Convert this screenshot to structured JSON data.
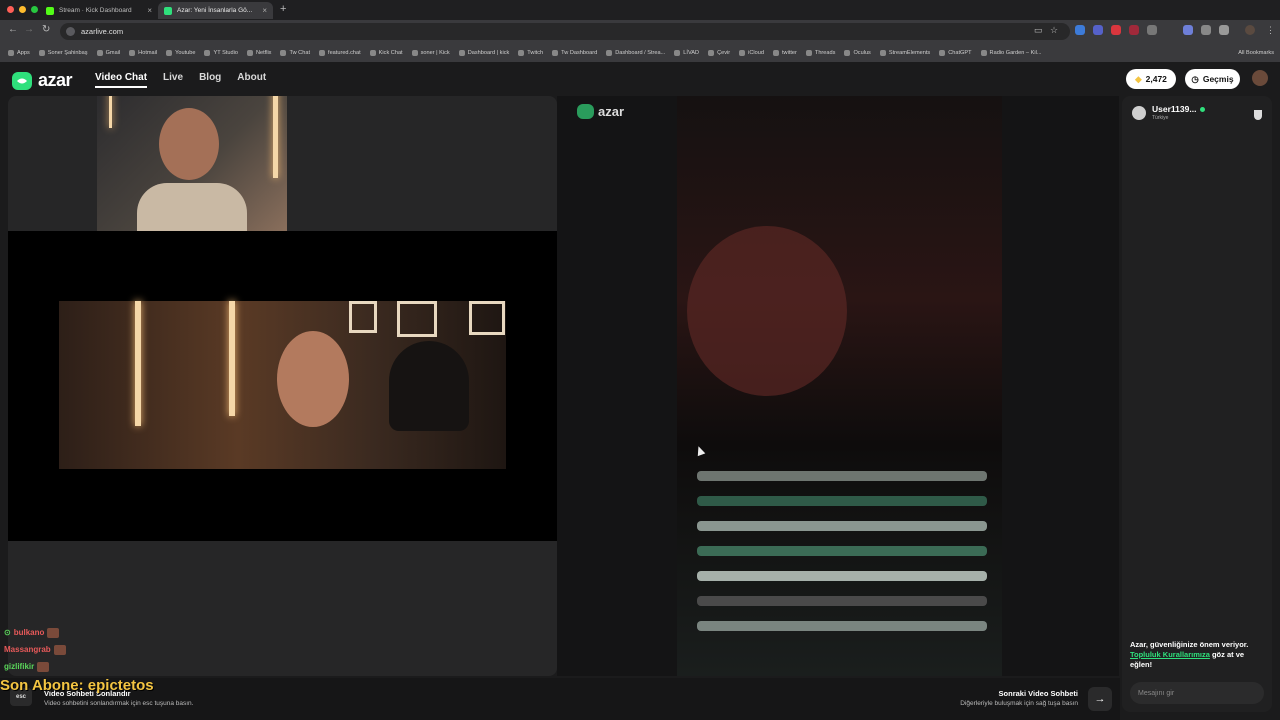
{
  "browser": {
    "tabs": [
      {
        "title": "Stream · Kick Dashboard",
        "favicon_color": "#53fc18",
        "active": false
      },
      {
        "title": "Azar: Yeni İnsanlarla Gö...",
        "favicon_color": "#2fe07c",
        "active": true
      }
    ],
    "url": "azarlive.com",
    "bookmarks": [
      "Apps",
      "Soner Şahinbaş",
      "Gmail",
      "Hotmail",
      "Youtube",
      "YT Studio",
      "Netflix",
      "Tw Chat",
      "featured.chat",
      "Kick Chat",
      "soner | Kick",
      "Dashboard | kick",
      "Twitch",
      "Tw Dashboard",
      "Dashboard / Strea...",
      "LİVAD",
      "Çevir",
      "iCloud",
      "twitter",
      "Threads",
      "Oculus",
      "StreamElements",
      "ChatGPT",
      "Radio Garden – Kil..."
    ],
    "all_bookmarks": "All Bookmarks"
  },
  "site": {
    "logo": "azar",
    "nav": [
      "Video Chat",
      "Live",
      "Blog",
      "About"
    ],
    "gems": "2,472",
    "history": "Geçmiş"
  },
  "peer": {
    "name": "User1139...",
    "country": "Türkiye",
    "mini_logo": "azar"
  },
  "chat": {
    "safety_text": "Azar, güvenliğinize önem veriyor.",
    "safety_link": "Topluluk Kurallarımıza",
    "safety_suffix": "göz at ve eğlen!",
    "placeholder": "Mesajını gir"
  },
  "bottom": {
    "esc_key": "esc",
    "end_title": "Video Sohbeti Sonlandır",
    "end_desc": "Video sohbetini sonlandırmak için esc tuşuna basın.",
    "next_title": "Sonraki Video Sohbeti",
    "next_desc": "Diğerleriyle buluşmak için sağ tuşa basın"
  },
  "overlay": {
    "recent": [
      {
        "name": "bulkano",
        "color": "#e85a5a"
      },
      {
        "name": "Massangrab",
        "color": "#e85a5a"
      },
      {
        "name": "gizlifikir",
        "color": "#5ad65a"
      }
    ],
    "last_sub": "Son Abone: epictetos"
  },
  "colors": {
    "accent": "#2fe07c",
    "sub_text": "#f4c542"
  }
}
